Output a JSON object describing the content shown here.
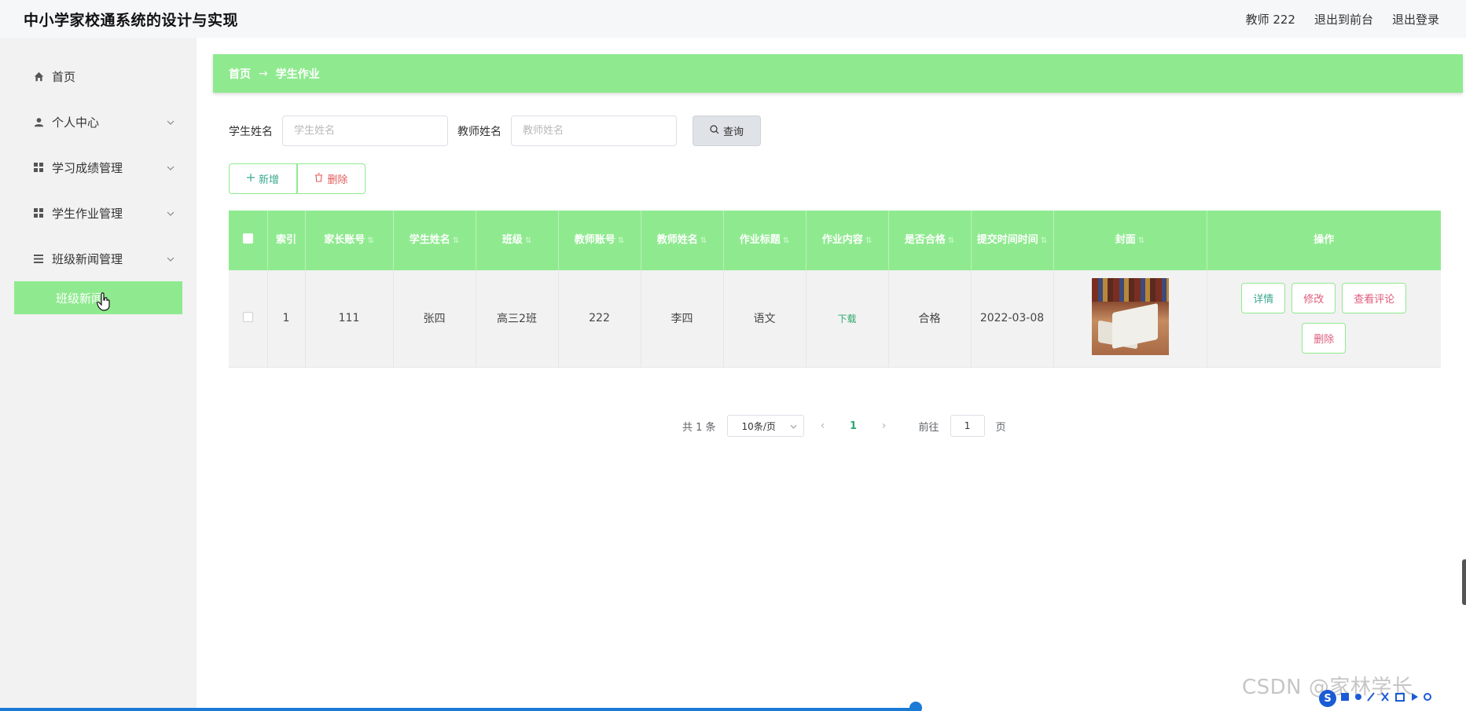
{
  "header": {
    "app_title": "中小学家校通系统的设计与实现",
    "user_label": "教师 222",
    "to_front": "退出到前台",
    "logout": "退出登录"
  },
  "sidebar": {
    "items": [
      {
        "label": "首页",
        "icon": "home-icon"
      },
      {
        "label": "个人中心",
        "icon": "user-icon"
      },
      {
        "label": "学习成绩管理",
        "icon": "grid-icon"
      },
      {
        "label": "学生作业管理",
        "icon": "grid-icon"
      },
      {
        "label": "班级新闻管理",
        "icon": "list-icon"
      }
    ],
    "active_sub": "班级新闻"
  },
  "breadcrumb": {
    "home": "首页",
    "arrow": "→",
    "current": "学生作业"
  },
  "search": {
    "student_label": "学生姓名",
    "student_placeholder": "学生姓名",
    "teacher_label": "教师姓名",
    "teacher_placeholder": "教师姓名",
    "query_label": "查询"
  },
  "actions": {
    "add_label": "新增",
    "delete_label": "删除"
  },
  "table": {
    "headers": [
      "索引",
      "家长账号",
      "学生姓名",
      "班级",
      "教师账号",
      "教师姓名",
      "作业标题",
      "作业内容",
      "是否合格",
      "提交时间时间",
      "封面",
      "操作"
    ],
    "rows": [
      {
        "index": "1",
        "parent_account": "111",
        "student_name": "张四",
        "class": "高三2班",
        "teacher_account": "222",
        "teacher_name": "李四",
        "title": "语文",
        "content": "下载",
        "qualified": "合格",
        "submit_time": "2022-03-08",
        "ops": {
          "detail": "详情",
          "edit": "修改",
          "comments": "查看评论",
          "delete": "删除"
        }
      }
    ]
  },
  "pagination": {
    "total": "共 1 条",
    "page_size": "10条/页",
    "current": "1",
    "goto_prefix": "前往",
    "goto_value": "1",
    "goto_suffix": "页"
  },
  "watermark": "CSDN @家林学长",
  "colors": {
    "accent_green": "#8fea8f",
    "link_teal": "#39a98f",
    "danger": "#e05a7a"
  }
}
